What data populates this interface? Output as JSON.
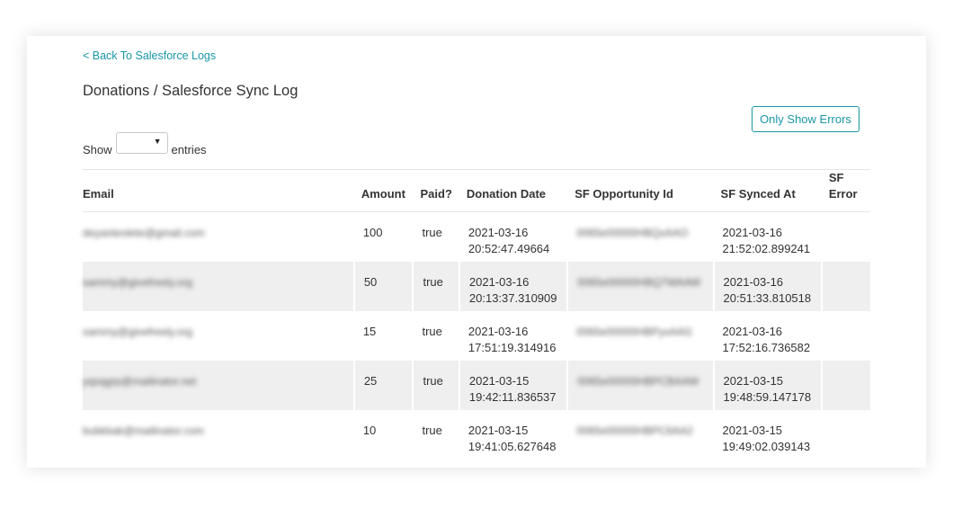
{
  "nav": {
    "back_label": "< Back To Salesforce Logs"
  },
  "page": {
    "title": "Donations / Salesforce Sync Log"
  },
  "filters": {
    "only_errors_label": "Only Show Errors"
  },
  "length": {
    "show_label": "Show",
    "entries_label": "entries",
    "selected": ""
  },
  "table": {
    "headers": [
      "Email",
      "Amount",
      "Paid?",
      "Donation Date",
      "SF Opportunity Id",
      "SF Synced At",
      "SF Error"
    ],
    "rows": [
      {
        "email": "deyanteolete@gmail.com",
        "amount": "100",
        "paid": "true",
        "donation_date": "2021-03-16 20:52:47.49664",
        "sf_id": "0065e00000HBQxAAO",
        "synced_at": "2021-03-16 21:52:02.899241",
        "error": ""
      },
      {
        "email": "sammy@givefreely.org",
        "amount": "50",
        "paid": "true",
        "donation_date": "2021-03-16 20:13:37.310909",
        "sf_id": "0065e00000HBQ7WAAW",
        "synced_at": "2021-03-16 20:51:33.810518",
        "error": ""
      },
      {
        "email": "sammy@givefreely.org",
        "amount": "15",
        "paid": "true",
        "donation_date": "2021-03-16 17:51:19.314916",
        "sf_id": "0065e00000HBPyxAAG",
        "synced_at": "2021-03-16 17:52:16.736582",
        "error": ""
      },
      {
        "email": "yqsqgrp@mailinator.net",
        "amount": "25",
        "paid": "true",
        "donation_date": "2021-03-15 19:42:11.836537",
        "sf_id": "0065e00000HBPCBAAW",
        "synced_at": "2021-03-15 19:48:59.147178",
        "error": ""
      },
      {
        "email": "bubkbak@mailinator.com",
        "amount": "10",
        "paid": "true",
        "donation_date": "2021-03-15 19:41:05.627648",
        "sf_id": "0065e00000HBPC6AA2",
        "synced_at": "2021-03-15 19:49:02.039143",
        "error": ""
      }
    ]
  }
}
